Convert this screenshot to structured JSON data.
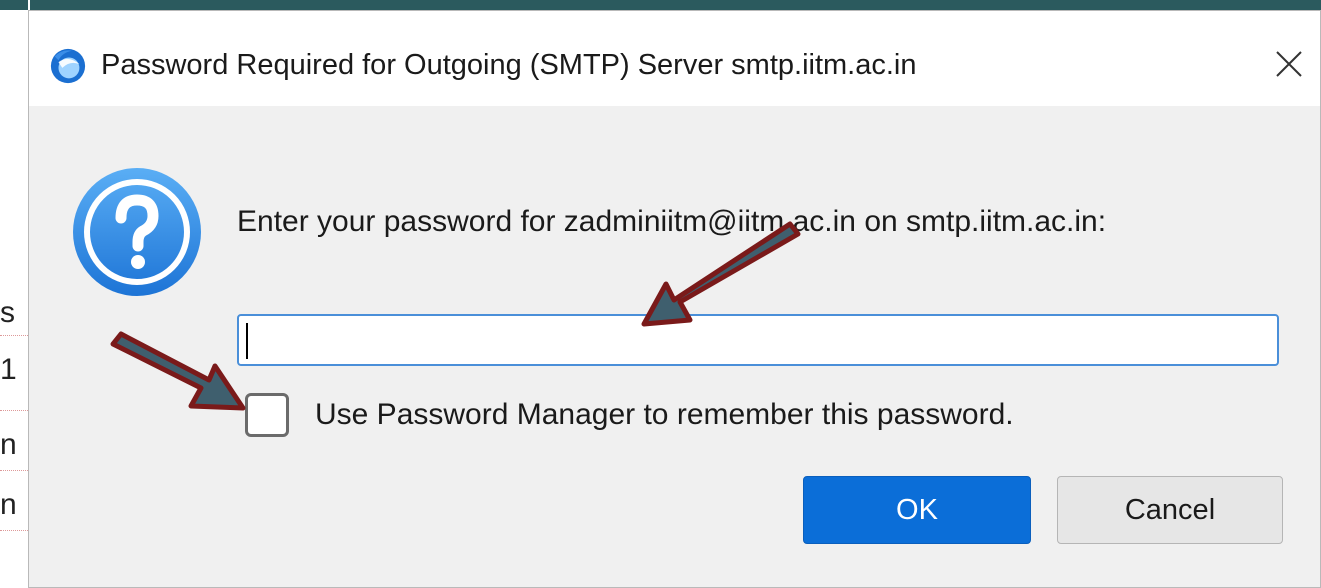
{
  "background_fragments": [
    "s",
    "1",
    "n",
    "n"
  ],
  "dialog": {
    "title": "Password Required for Outgoing (SMTP) Server smtp.iitm.ac.in",
    "prompt": "Enter your password for zadminiitm@iitm.ac.in on smtp.iitm.ac.in:",
    "password_value": "",
    "remember_label": "Use Password Manager to remember this password.",
    "remember_checked": false,
    "ok_label": "OK",
    "cancel_label": "Cancel"
  },
  "icons": {
    "app": "thunderbird-icon",
    "close": "close-icon",
    "question": "question-icon",
    "annotation": "arrow-icon"
  },
  "colors": {
    "accent": "#0b6ed8",
    "annotation_arrow_fill": "#3f5f6e",
    "annotation_arrow_stroke": "#7a1a1a"
  }
}
